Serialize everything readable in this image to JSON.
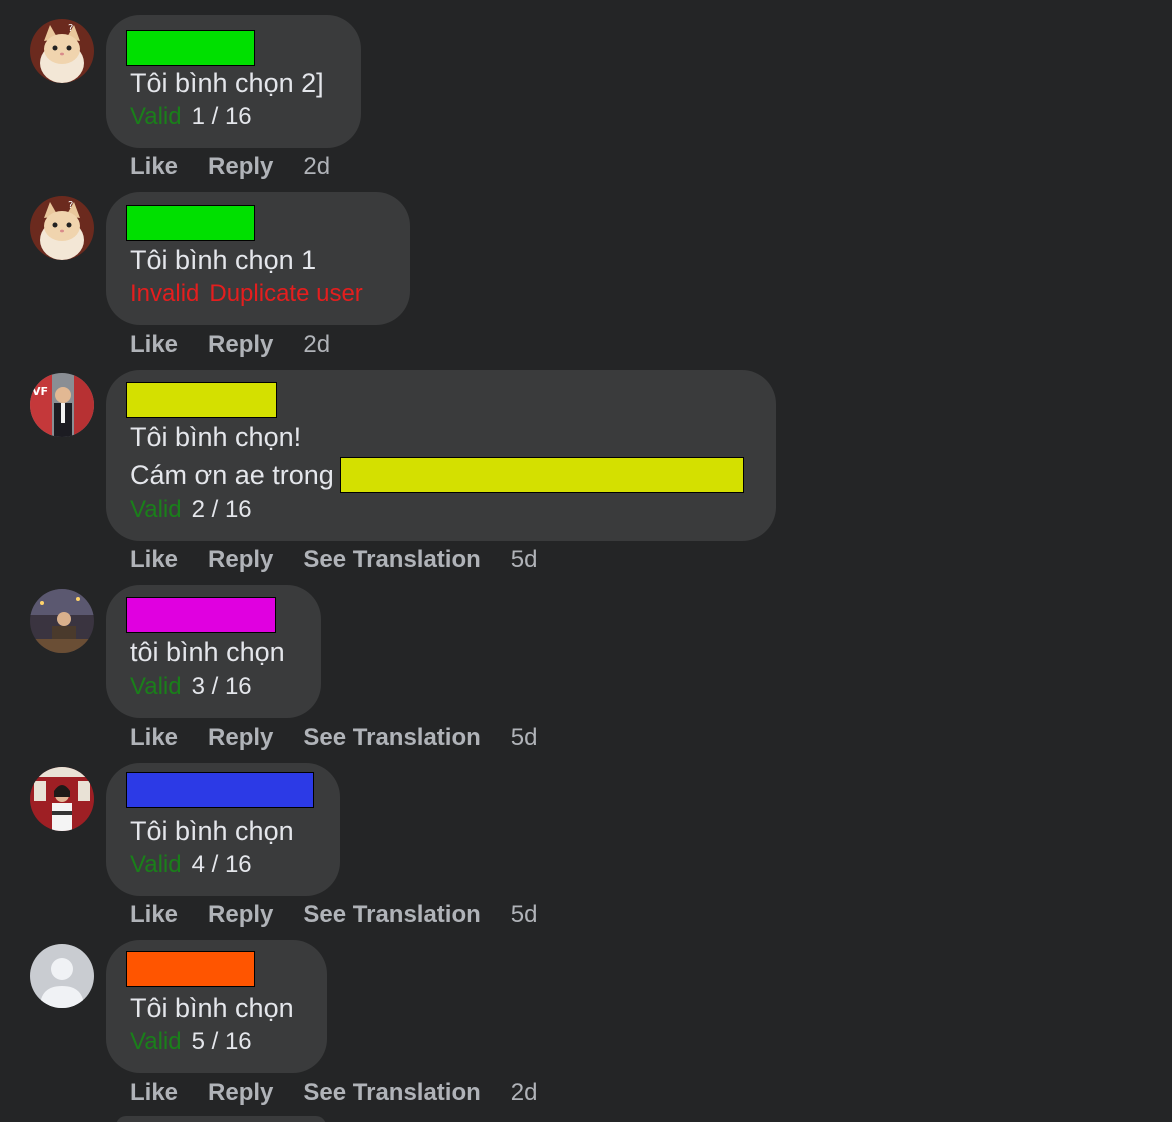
{
  "colors": {
    "background": "#242526",
    "bubble": "#3a3b3c",
    "valid": "#1a7f1a",
    "invalid": "#e41e1e",
    "action_text": "#b0b3b8"
  },
  "comments": [
    {
      "avatar": "cat-avatar",
      "name_redaction_color": "#00e000",
      "lines": [
        "Tôi bình chọn 2]"
      ],
      "status": "Valid",
      "count": "1 / 16",
      "actions": {
        "like": "Like",
        "reply": "Reply",
        "time": "2d"
      }
    },
    {
      "avatar": "cat-avatar",
      "name_redaction_color": "#00e000",
      "lines": [
        "Tôi bình chọn 1"
      ],
      "status": "Invalid",
      "reason": "Duplicate user",
      "actions": {
        "like": "Like",
        "reply": "Reply",
        "time": "2d"
      }
    },
    {
      "avatar": "man-suit-avatar",
      "name_redaction_color": "#d4e000",
      "lines": [
        "Tôi bình chọn!",
        "Cám ơn ae trong"
      ],
      "inline_redaction_color": "#d4e000",
      "status": "Valid",
      "count": "2 / 16",
      "actions": {
        "like": "Like",
        "reply": "Reply",
        "translate": "See Translation",
        "time": "5d"
      }
    },
    {
      "avatar": "night-street-avatar",
      "name_redaction_color": "#e000e0",
      "lines": [
        "tôi bình chọn"
      ],
      "status": "Valid",
      "count": "3 / 16",
      "actions": {
        "like": "Like",
        "reply": "Reply",
        "translate": "See Translation",
        "time": "5d"
      }
    },
    {
      "avatar": "woman-red-background-avatar",
      "name_redaction_color": "#2c3ae6",
      "lines": [
        "Tôi bình chọn"
      ],
      "status": "Valid",
      "count": "4 / 16",
      "actions": {
        "like": "Like",
        "reply": "Reply",
        "translate": "See Translation",
        "time": "5d"
      }
    },
    {
      "avatar": "default-user-avatar",
      "name_redaction_color": "#ff5500",
      "lines": [
        "Tôi bình chọn"
      ],
      "status": "Valid",
      "count": "5 / 16",
      "actions": {
        "like": "Like",
        "reply": "Reply",
        "translate": "See Translation",
        "time": "2d"
      }
    }
  ]
}
